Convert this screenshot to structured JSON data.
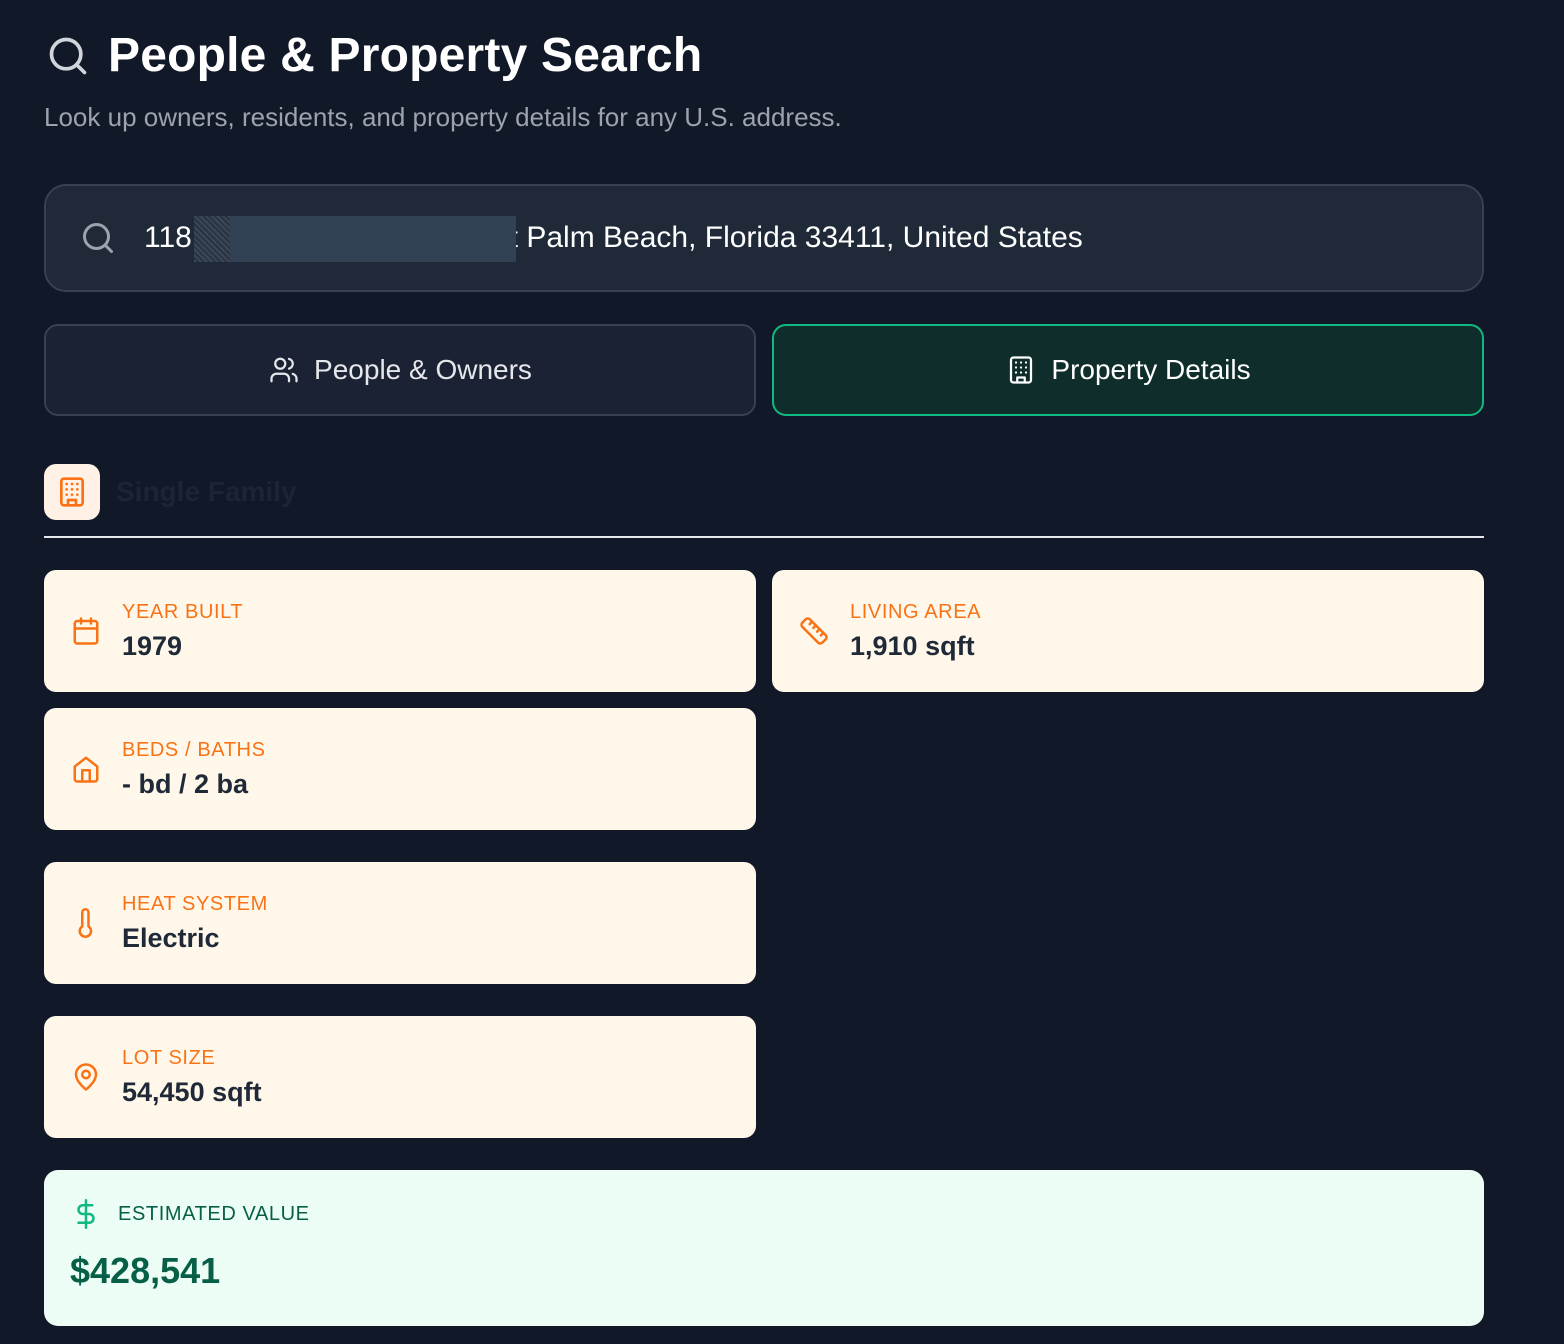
{
  "header": {
    "title": "People & Property Search",
    "subtitle": "Look up owners, residents, and property details for any U.S. address.",
    "icon": "search-icon"
  },
  "search": {
    "value": "118                               West Palm Beach, Florida 33411, United States",
    "icon": "search-icon"
  },
  "tabs": [
    {
      "label": "People & Owners",
      "icon": "users-icon",
      "active": false
    },
    {
      "label": "Property Details",
      "icon": "building-icon",
      "active": true
    }
  ],
  "property_type": {
    "label": "Single Family",
    "icon": "building-icon"
  },
  "details": {
    "year_built": {
      "label": "YEAR BUILT",
      "value": "1979",
      "icon": "calendar-icon"
    },
    "living_area": {
      "label": "LIVING AREA",
      "value": "1,910 sqft",
      "icon": "ruler-icon"
    },
    "beds_baths": {
      "label": "BEDS / BATHS",
      "value": "- bd / 2 ba",
      "icon": "home-icon"
    },
    "heat_system": {
      "label": "HEAT SYSTEM",
      "value": "Electric",
      "icon": "thermometer-icon"
    },
    "lot_size": {
      "label": "LOT SIZE",
      "value": "54,450 sqft",
      "icon": "map-pin-icon"
    }
  },
  "estimated_value": {
    "label": "ESTIMATED VALUE",
    "amount": "$428,541",
    "icon": "dollar-icon"
  },
  "colors": {
    "background": "#111827",
    "accent_green": "#10b981",
    "accent_orange": "#f97316",
    "card_bg": "#fff8ea",
    "value_bg": "#ecfdf5"
  }
}
